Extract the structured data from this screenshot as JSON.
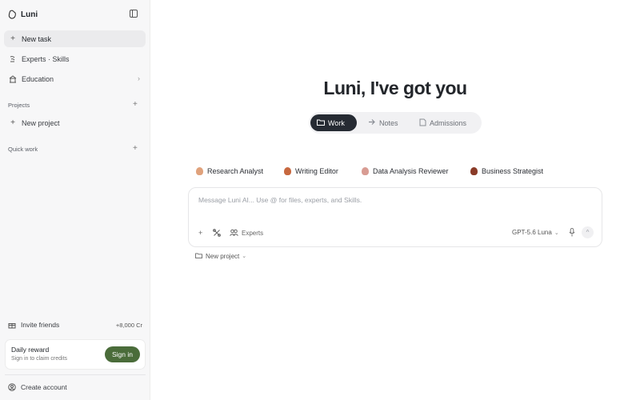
{
  "app": {
    "name": "Luni"
  },
  "sidebar": {
    "new_task": "New task",
    "experts": "Experts · Skills",
    "education": "Education",
    "projects_label": "Projects",
    "new_project": "New project",
    "quick_work_label": "Quick work",
    "invite": "Invite friends",
    "invite_credits": "+8,000 Cr",
    "reward": {
      "title": "Daily reward",
      "subtitle": "Sign in to claim credits",
      "button": "Sign in"
    },
    "create_account": "Create account"
  },
  "main": {
    "hero": "Luni, I've got you",
    "tabs": [
      {
        "label": "Work",
        "icon": "folder-icon",
        "active": true
      },
      {
        "label": "Notes",
        "icon": "notes-icon",
        "active": false
      },
      {
        "label": "Admissions",
        "icon": "admissions-icon",
        "active": false
      }
    ],
    "experts": [
      {
        "label": "Research Analyst",
        "color": "#e0a27c"
      },
      {
        "label": "Writing Editor",
        "color": "#c7683f"
      },
      {
        "label": "Data Analysis Reviewer",
        "color": "#d89c93"
      },
      {
        "label": "Business Strategist",
        "color": "#8a3b28"
      }
    ],
    "composer": {
      "placeholder": "Message Luni AI... Use @ for files, experts, and Skills.",
      "experts_button": "Experts",
      "model": "GPT-5.6 Luna"
    },
    "project_select": "New project"
  },
  "colors": {
    "accent_dark": "#262b33",
    "signin_green": "#4a6c3a"
  }
}
